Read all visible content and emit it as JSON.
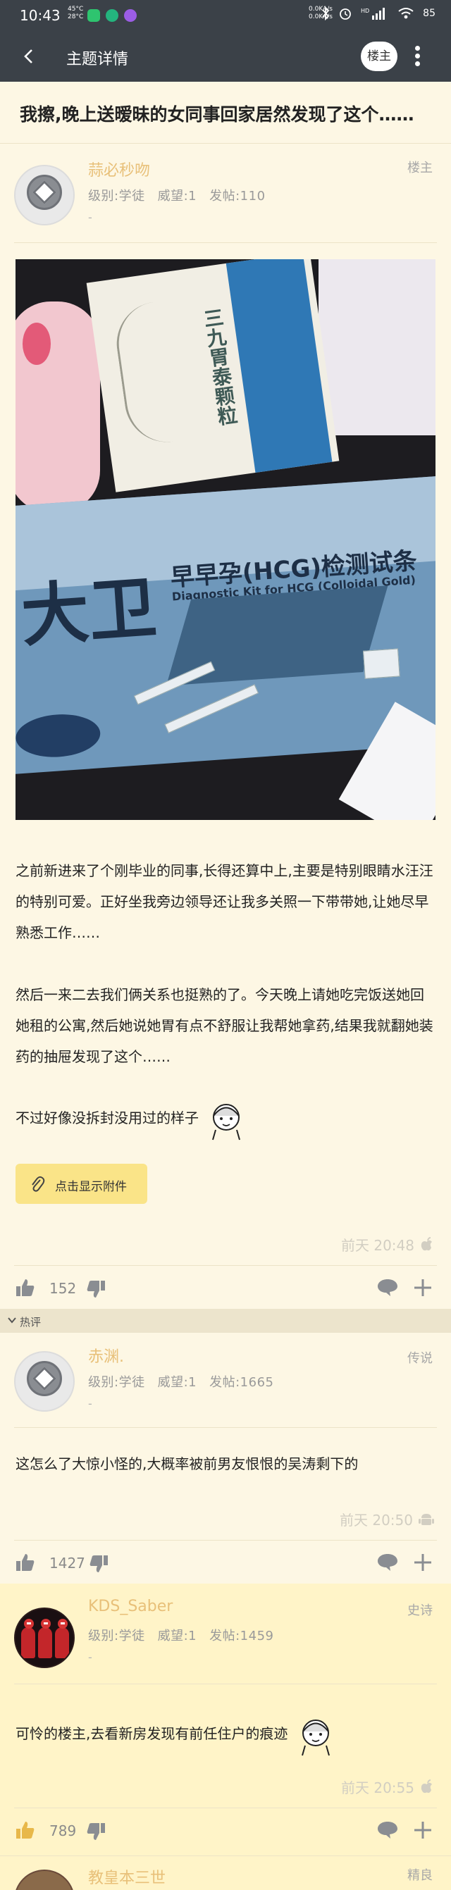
{
  "status_bar": {
    "time": "10:43",
    "temp_top": "45°C",
    "temp_bottom": "28°C",
    "net_top": "0.0KA/s",
    "net_bottom": "0.0KA/s",
    "battery": "85"
  },
  "header": {
    "title": "主题详情",
    "owner_button": "楼主"
  },
  "thread": {
    "title": "我擦,晚上送暧昧的女同事回家居然发现了这个……"
  },
  "op": {
    "username": "蒜必秒吻",
    "level": "级别:学徒",
    "prestige": "威望:1",
    "posts": "发帖:110",
    "dash": "-",
    "floor": "楼主",
    "paragraph1": "之前新进来了个刚毕业的同事,长得还算中上,主要是特别眼睛水汪汪的特别可爱。正好坐我旁边领导还让我多关照一下带带她,让她尽早熟悉工作……",
    "paragraph2": "然后一来二去我们俩关系也挺熟的了。今天晚上请她吃完饭送她回她租的公寓,然后她说她胃有点不舒服让我帮她拿药,结果我就翻她装药的抽屉发现了这个……",
    "paragraph3": "不过好像没拆封没用过的样子",
    "attach_button": "点击显示附件",
    "time": "前天 20:48",
    "likes": "152",
    "photo": {
      "box_top_text": "三九胃泰颗粒",
      "brand": "大卫",
      "product": "早早孕(HCG)检测试条",
      "english": "Diagnostic Kit for HCG (Colloidal Gold)"
    }
  },
  "hot_label": "热评",
  "replies": [
    {
      "username": "赤渊.",
      "level": "级别:学徒",
      "prestige": "威望:1",
      "posts": "发帖:1665",
      "dash": "-",
      "floor": "传说",
      "text": "这怎么了大惊小怪的,大概率被前男友恨恨的吴涛剩下的",
      "time": "前天 20:50",
      "likes": "1427"
    },
    {
      "username": "KDS_Saber",
      "level": "级别:学徒",
      "prestige": "威望:1",
      "posts": "发帖:1459",
      "dash": "-",
      "floor": "史诗",
      "text": "可怜的楼主,去看新房发现有前任住户的痕迹",
      "time": "前天 20:55",
      "likes": "789"
    },
    {
      "username": "教皇本三世",
      "floor": "精良"
    }
  ],
  "colors": {
    "bar": "#3b4148",
    "background": "#fdf7e4",
    "username": "#e8c079",
    "attach": "#fae488",
    "hot_bar": "#ece4cc"
  }
}
